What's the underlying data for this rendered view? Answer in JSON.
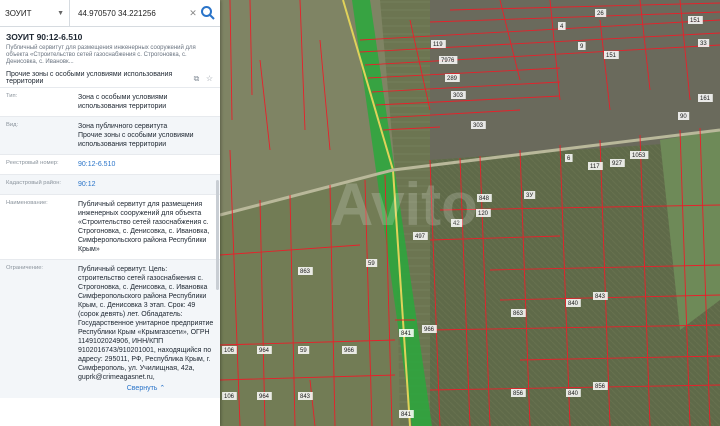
{
  "search": {
    "zone_select": "ЗОУИТ",
    "coords": "44.970570 34.221256",
    "clear_glyph": "✕"
  },
  "card": {
    "title": "ЗОУИТ 90:12-6.510",
    "subtitle": "Публичный сервитут для размещения инженерных сооружений для объекта «Строительство сетей газоснабжения с. Строгоновка, с. Денисовка, с. Ивановк...",
    "category": "Прочие зоны с особыми условиями использования территории",
    "fields": [
      {
        "label": "Тип:",
        "value": "Зона с особыми условиями использования территории",
        "link": false
      },
      {
        "label": "Вид:",
        "value": "Зона публичного сервитута\nПрочие зоны с особыми условиями использования территории",
        "link": false
      },
      {
        "label": "Реестровый номер:",
        "value": "90:12-6.510",
        "link": true
      },
      {
        "label": "Кадастровый район:",
        "value": "90:12",
        "link": true
      },
      {
        "label": "Наименование:",
        "value": "Публичный сервитут для размещения инженерных сооружений для объекта «Строительство сетей газоснабжения с. Строгоновка, с. Денисовка, с. Ивановка, Симферопольского района Республики Крым»",
        "link": false
      },
      {
        "label": "Ограничение:",
        "value": "Публичный сервитут. Цель: строительство сетей газоснабжения с. Строгоновка, с. Денисовка, с. Ивановка Симферопольского района Республики Крым, с. Денисовка 3 этап. Срок: 49 (сорок девять) лет. Обладатель: Государственное унитарное предприятие Республики Крым «Крымгазсети», ОГРН 1149102024906, ИНН/КПП 9102016743/910201001, находящийся по адресу: 295011, РФ, Республика Крым, г. Симферополь, ул. Училищная, 42а, guprk@crimeagasnet.ru,",
        "link": false
      }
    ],
    "collapse": "Свернуть ⌃"
  },
  "map": {
    "parcel_labels": [
      "26",
      "151",
      "119",
      "4",
      "7976",
      "151",
      "289",
      "33",
      "303",
      "303",
      "161",
      "9",
      "6",
      "117",
      "927",
      "1053",
      "90",
      "3У",
      "848",
      "120",
      "42",
      "497",
      "59",
      "863",
      "840",
      "843",
      "863",
      "840",
      "856",
      "841",
      "966",
      "106",
      "964",
      "59",
      "966",
      "106",
      "964",
      "843",
      "856",
      "841"
    ],
    "watermark": "Avito",
    "colors": {
      "parcel_line": "#e8202a",
      "servitude": "#2aa83c",
      "road": "#e0d25a"
    }
  }
}
